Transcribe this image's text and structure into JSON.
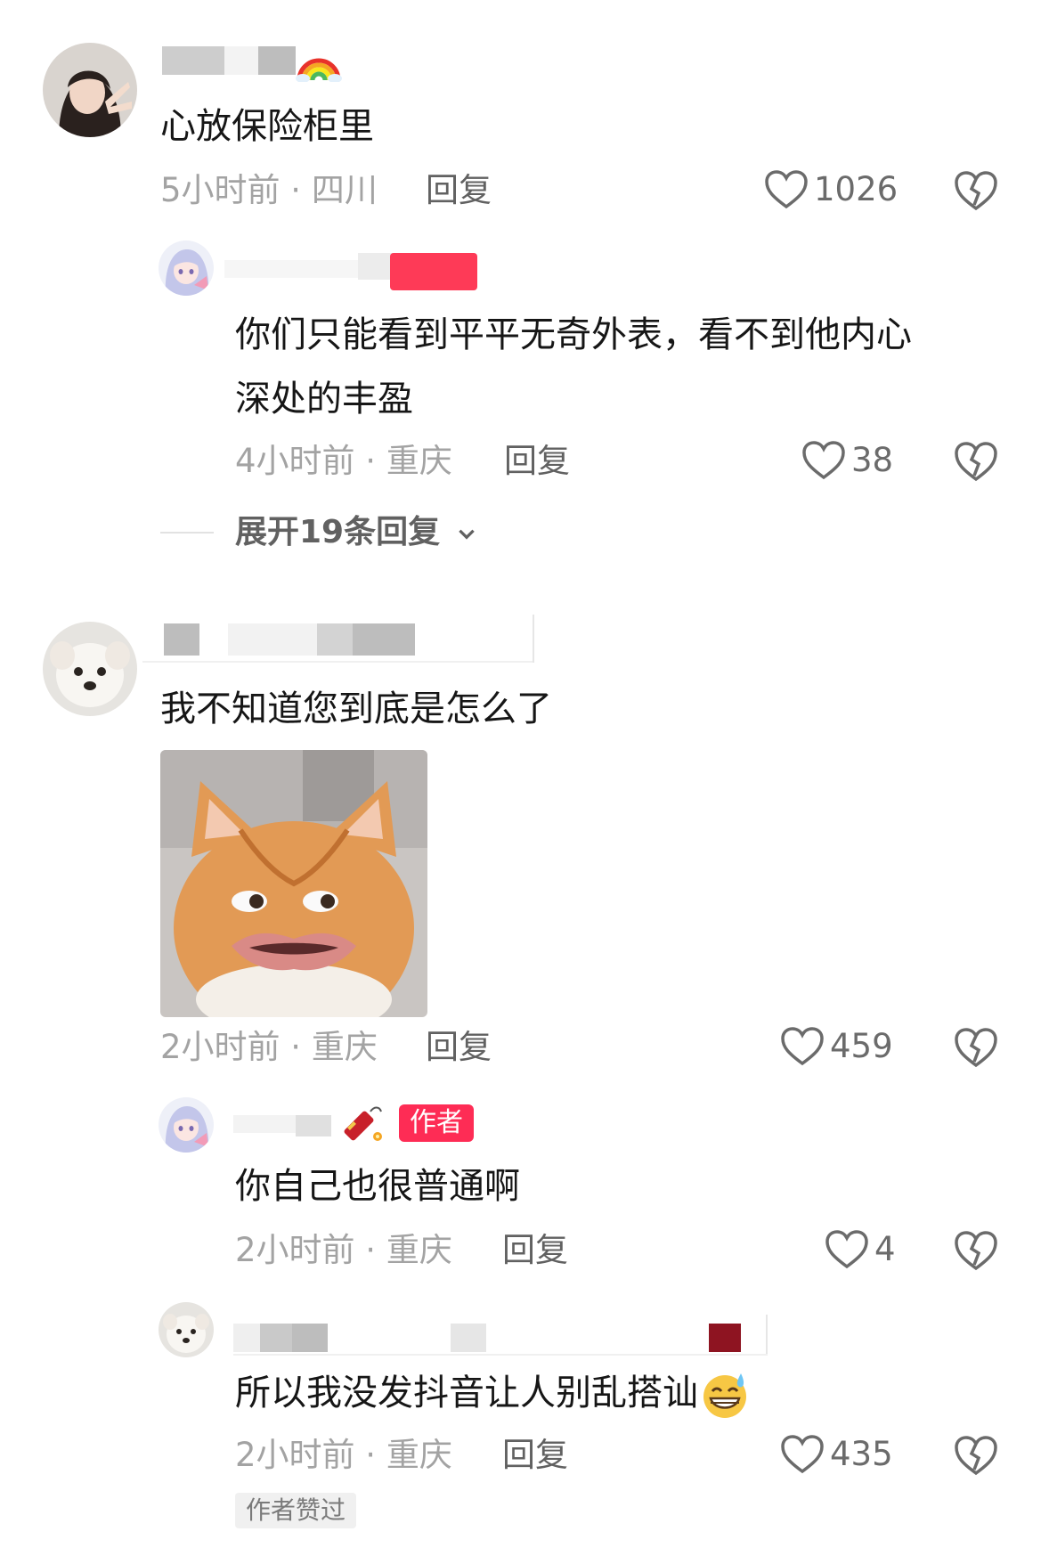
{
  "comments": [
    {
      "text": "心放保险柜里",
      "meta": "5小时前 · 四川",
      "reply_label": "回复",
      "likes": "1026",
      "replies": [
        {
          "text_line1": "你们只能看到平平无奇外表，看不到他内心",
          "text_line2": "深处的丰盈",
          "meta": "4小时前 · 重庆",
          "reply_label": "回复",
          "likes": "38"
        }
      ],
      "expand_label": "展开19条回复"
    },
    {
      "text": "我不知道您到底是怎么了",
      "meta": "2小时前 · 重庆",
      "reply_label": "回复",
      "likes": "459",
      "replies": [
        {
          "badge": "作者",
          "text": "你自己也很普通啊",
          "meta": "2小时前 · 重庆",
          "reply_label": "回复",
          "likes": "4"
        },
        {
          "text": "所以我没发抖音让人别乱搭讪",
          "meta": "2小时前 · 重庆",
          "reply_label": "回复",
          "likes": "435",
          "liked_badge": "作者赞过"
        }
      ]
    }
  ],
  "icons": {
    "like": "heart-outline-icon",
    "dislike": "broken-heart-icon",
    "expand": "chevron-down-icon"
  },
  "colors": {
    "accent": "#fe2c55",
    "meta_text": "#a3a3a3",
    "body_text": "#161616"
  }
}
